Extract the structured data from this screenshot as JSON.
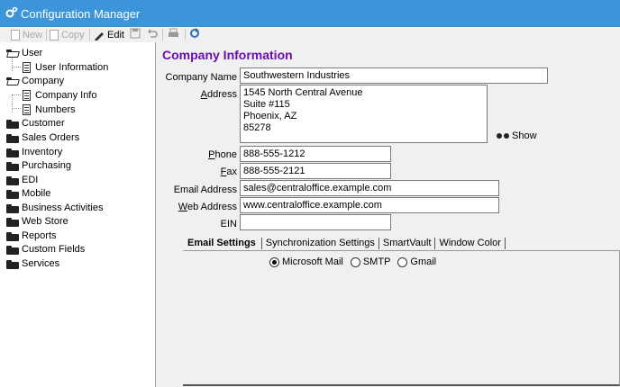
{
  "window": {
    "title": "Configuration Manager",
    "title_bg": "#3c95d9"
  },
  "toolbar": {
    "new_label": "New",
    "copy_label": "Copy",
    "edit_label": "Edit"
  },
  "tree": {
    "user": "User",
    "user_information": "User Information",
    "company": "Company",
    "company_info": "Company Info",
    "numbers": "Numbers",
    "items": [
      "Customer",
      "Sales Orders",
      "Inventory",
      "Purchasing",
      "EDI",
      "Mobile",
      "Business Activities",
      "Web Store",
      "Reports",
      "Custom Fields",
      "Services"
    ]
  },
  "main": {
    "section_title": "Company Information",
    "title_color": "#6a0dad",
    "company_name_label": "Company Name",
    "company_name": "Southwestern Industries",
    "address_label": "Address",
    "address_lines": [
      "1545 North Central Avenue",
      "Suite #115",
      "Phoenix, AZ",
      "85278"
    ],
    "show_label": "Show",
    "phone_label": "Phone",
    "phone": "888-555-1212",
    "fax_label": "Fax",
    "fax": "888-555-2121",
    "email_label": "Email Address",
    "email": "sales@centraloffice.example.com",
    "web_label": "Web Address",
    "web": "www.centraloffice.example.com",
    "ein_label": "EIN",
    "ein": ""
  },
  "tabs": [
    "Email Settings",
    "Synchronization Settings",
    "SmartVault",
    "Window Color"
  ],
  "email_settings": {
    "options": [
      "Microsoft Mail",
      "SMTP",
      "Gmail"
    ],
    "selected": "Microsoft Mail"
  }
}
